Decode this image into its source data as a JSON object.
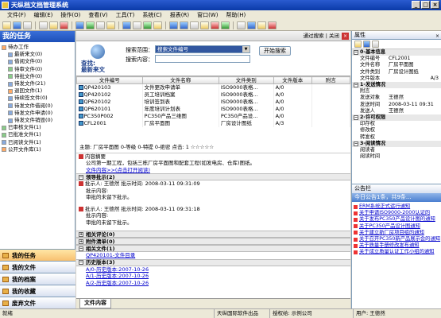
{
  "app": {
    "title": "天纵档文档管理系统"
  },
  "menu": [
    "文件(F)",
    "编辑(E)",
    "操作(O)",
    "查看(V)",
    "工具(T)",
    "系统(C)",
    "报表(R)",
    "窗口(W)",
    "帮助(H)"
  ],
  "left": {
    "title": "我的任务",
    "tree": [
      {
        "label": "待办工作",
        "level": 0
      },
      {
        "label": "最新来文(0)",
        "level": 1
      },
      {
        "label": "借阅文件(0)",
        "level": 1
      },
      {
        "label": "待审文件(0)",
        "level": 1
      },
      {
        "label": "待批文件(0)",
        "level": 1
      },
      {
        "label": "待发文件(21)",
        "level": 1
      },
      {
        "label": "退回文件(1)",
        "level": 1
      },
      {
        "label": "待续签文件(0)",
        "level": 1
      },
      {
        "label": "待发文件借阅(0)",
        "level": 1
      },
      {
        "label": "待发文件申请(0)",
        "level": 1
      },
      {
        "label": "待发文件销毁(0)",
        "level": 1
      },
      {
        "label": "已审核文件(1)",
        "level": 0
      },
      {
        "label": "已批准文件(1)",
        "level": 0
      },
      {
        "label": "已阅读文件(1)",
        "level": 0
      },
      {
        "label": "公开文件库(1)",
        "level": 0
      }
    ],
    "nav": [
      "我的任务",
      "我的文件",
      "我的档案",
      "我的收藏",
      "废弃文件"
    ]
  },
  "search": {
    "header": "通过搜索 | 关闭",
    "logo_line1": "查找:",
    "logo_line2": "最新来文",
    "label_range": "搜索范围：",
    "selected_range": "搜索文件编号",
    "label_content": "搜索内容：",
    "button": "开始搜索"
  },
  "grid": {
    "columns": [
      "文件编号",
      "文件名称",
      "文件类别",
      "文件版本",
      "附言"
    ],
    "rows": [
      [
        "QP420103",
        "文件更改申请单",
        "ISO9000表格...",
        "A/0",
        ""
      ],
      [
        "QP420102",
        "员工培训档案",
        "ISO9000表格...",
        "A/0",
        ""
      ],
      [
        "QP620102",
        "培训签到表",
        "ISO9000表格...",
        "A/0",
        ""
      ],
      [
        "QP620101",
        "年度培训计划表",
        "ISO9000表格...",
        "A/0",
        ""
      ],
      [
        "PC350P002",
        "PC350产品三维图",
        "PC350产品设...",
        "A/0",
        ""
      ],
      [
        "CFL2001",
        "厂房平面图",
        "厂房设计图纸",
        "A/3",
        ""
      ]
    ]
  },
  "detail": {
    "header": "主题: 厂房平面图   0-等级   0-特提   0-绝密   点击: 1 ☆☆☆☆☆",
    "summary_title": "内容摘要",
    "summary_text": "公司第一期工程，包括三栋厂房平面图和配套工程(如发电房、仓库)图纸。",
    "summary_link": "文件内容>>(点击打开阅读)",
    "section_leader": "领导批示(2)",
    "approvals": [
      {
        "who": "批示人: 王德然   批示时间: 2008-03-11 09:31:09",
        "l1": "批示内容:",
        "l2": "审批的未留下批示。"
      },
      {
        "who": "批示人: 王德然   批示时间: 2008-03-11 09:31:18",
        "l1": "批示内容:",
        "l2": "审批的未留下批示。"
      }
    ],
    "section_comments": "相关评论(0)",
    "section_attach": "附件清单(0)",
    "section_related": "相关文件(1)",
    "related_link": "QP420101-文件目录",
    "section_history": "历史版本(3)",
    "history": [
      "A/0-历史版本:2007-10-26",
      "A/1-历史版本:2007-10-26",
      "A/2-历史版本:2007-10-26"
    ],
    "bottom_tab": "文件内容"
  },
  "right": {
    "header": "属性",
    "groups": [
      {
        "title": "0-基本信息",
        "rows": [
          [
            "文件编号",
            "CFL2001"
          ],
          [
            "文件名称",
            "厂房平面图"
          ],
          [
            "文件类别",
            "厂房设计图纸"
          ],
          [
            "文件版本",
            "A/3"
          ]
        ]
      },
      {
        "title": "1-发送情况",
        "rows": [
          [
            "附言",
            ""
          ],
          [
            "发送对象",
            "王德然"
          ],
          [
            "发送时间",
            "2008-03-11 09:31"
          ],
          [
            "发送人",
            "王德然"
          ]
        ]
      },
      {
        "title": "2-许可权限",
        "rows": [
          [
            "印存权",
            ""
          ],
          [
            "修改权",
            ""
          ],
          [
            "转发权",
            ""
          ]
        ]
      },
      {
        "title": "3-阅读情况",
        "rows": [
          [
            "阅读者",
            ""
          ],
          [
            "阅读时间",
            ""
          ]
        ]
      }
    ],
    "notice_header": "公告栏",
    "notice_banner": "今日公告1条，共9条...",
    "news": [
      "ERM系统正式运行通知",
      "关于申请ISO9000-2000认证的",
      "关于发布PC350产品设计图的通知",
      "关于PC350产品设计图通知",
      "关于建立新厂房项目组的通知",
      "关于召开PC350新产品展示会的通知",
      "关于质量手册修改发布通知",
      "关于成立质量认证工作小组的通知"
    ]
  },
  "status": [
    "就绪",
    "天纵国际软件出品",
    "授权给: 示例公司",
    "用户: 王德然"
  ]
}
